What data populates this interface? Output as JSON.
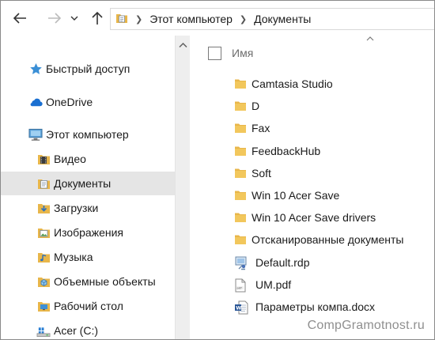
{
  "address_bar": {
    "crumbs": [
      "Этот компьютер",
      "Документы"
    ]
  },
  "nav_pane": {
    "items": [
      {
        "label": "Быстрый доступ",
        "icon": "star-icon",
        "level": 0
      },
      {
        "label": "OneDrive",
        "icon": "cloud-icon",
        "level": 0
      },
      {
        "label": "Этот компьютер",
        "icon": "computer-icon",
        "level": 0
      },
      {
        "label": "Видео",
        "icon": "video-folder-icon",
        "level": 1
      },
      {
        "label": "Документы",
        "icon": "documents-folder-icon",
        "level": 1,
        "selected": true
      },
      {
        "label": "Загрузки",
        "icon": "downloads-folder-icon",
        "level": 1
      },
      {
        "label": "Изображения",
        "icon": "pictures-folder-icon",
        "level": 1
      },
      {
        "label": "Музыка",
        "icon": "music-folder-icon",
        "level": 1
      },
      {
        "label": "Объемные объекты",
        "icon": "3d-objects-folder-icon",
        "level": 1
      },
      {
        "label": "Рабочий стол",
        "icon": "desktop-folder-icon",
        "level": 1
      },
      {
        "label": "Acer (C:)",
        "icon": "drive-icon",
        "level": 1
      }
    ]
  },
  "content": {
    "column_header": "Имя",
    "files": [
      {
        "name": "Camtasia Studio",
        "type": "folder"
      },
      {
        "name": "D",
        "type": "folder"
      },
      {
        "name": "Fax",
        "type": "folder"
      },
      {
        "name": "FeedbackHub",
        "type": "folder"
      },
      {
        "name": "Soft",
        "type": "folder"
      },
      {
        "name": "Win 10 Acer Save",
        "type": "folder"
      },
      {
        "name": "Win 10 Acer Save drivers",
        "type": "folder"
      },
      {
        "name": "Отсканированные документы",
        "type": "folder"
      },
      {
        "name": "Default.rdp",
        "type": "rdp"
      },
      {
        "name": "UM.pdf",
        "type": "pdf"
      },
      {
        "name": "Параметры компа.docx",
        "type": "docx"
      }
    ]
  },
  "watermark": "CompGramotnost.ru",
  "colors": {
    "folder": "#e8b64a",
    "selection": "#e5e5e5",
    "onedrive": "#1a6fd1",
    "star": "#3a8fd6"
  }
}
